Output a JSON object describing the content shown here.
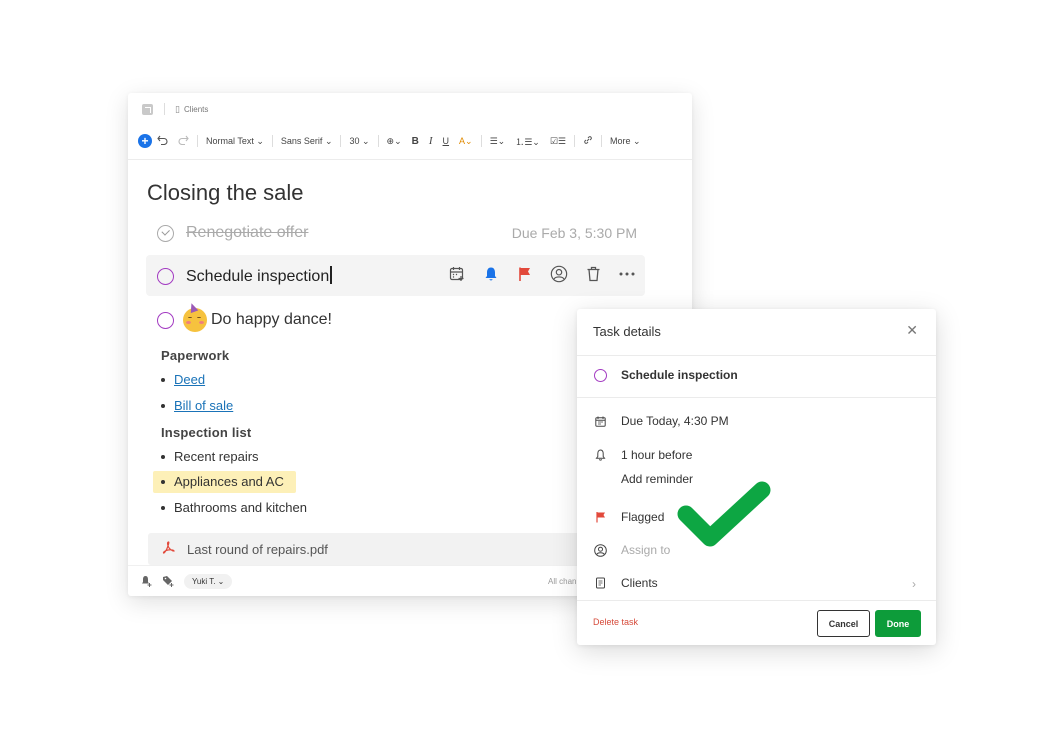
{
  "editor": {
    "breadcrumb": "Clients",
    "toolbar": {
      "text_style": "Normal Text",
      "font_family": "Sans Serif",
      "font_size": "30",
      "bold": "B",
      "italic": "I",
      "underline": "U",
      "more": "More"
    },
    "title": "Closing the sale",
    "tasks": [
      {
        "label": "Renegotiate offer",
        "due": "Due Feb 3, 5:30 PM",
        "completed": true
      },
      {
        "label": "Schedule inspection",
        "completed": false
      },
      {
        "label": "Do happy dance!",
        "completed": false
      }
    ],
    "sections": [
      {
        "heading": "Paperwork",
        "items": [
          "Deed",
          "Bill of sale"
        ]
      },
      {
        "heading": "Inspection list",
        "items": [
          "Recent repairs",
          "Appliances and AC",
          "Bathrooms and kitchen"
        ]
      }
    ],
    "attachment": "Last round of repairs.pdf",
    "footer": {
      "user": "Yuki T.",
      "status": "All chan"
    }
  },
  "task_details": {
    "title": "Task details",
    "task_name": "Schedule inspection",
    "due": "Due Today, 4:30 PM",
    "reminder": "1 hour before",
    "add_reminder": "Add reminder",
    "flag": "Flagged",
    "assign_placeholder": "Assign to",
    "notebook": "Clients",
    "delete_label": "Delete task",
    "cancel_label": "Cancel",
    "done_label": "Done"
  },
  "colors": {
    "accent_purple": "#a33bc2",
    "done_green": "#0d9c3a",
    "flag_red": "#e2493b",
    "bell_blue": "#1a73e8",
    "highlight": "#fdf0b8"
  }
}
